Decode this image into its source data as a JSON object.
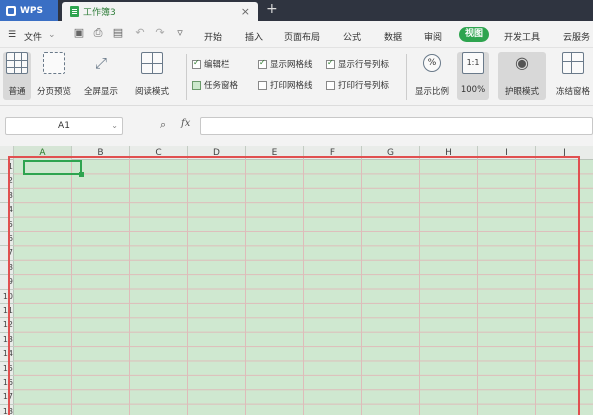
{
  "titlebar": {
    "app_label": "WPS",
    "doc_tab": "工作簿3",
    "close": "×",
    "new_tab": "+"
  },
  "menu": {
    "file": "文件",
    "tabs": [
      "开始",
      "插入",
      "页面布局",
      "公式",
      "数据",
      "审阅",
      "视图",
      "开发工具",
      "云服务"
    ],
    "active_tab": "视图"
  },
  "ribbon": {
    "buttons": [
      "普通",
      "分页预览",
      "全屏显示",
      "阅读模式",
      "显示比例",
      "100%",
      "护眼模式",
      "冻结窗格"
    ],
    "checks": [
      {
        "label": "编辑栏",
        "checked": true
      },
      {
        "label": "任务窗格",
        "checked": false
      },
      {
        "label": "显示网格线",
        "checked": true
      },
      {
        "label": "打印网格线",
        "checked": false
      },
      {
        "label": "显示行号列标",
        "checked": true
      },
      {
        "label": "打印行号列标",
        "checked": false
      }
    ]
  },
  "formula": {
    "name_box": "A1",
    "fx": "fx",
    "value": ""
  },
  "sheet": {
    "columns": [
      "A",
      "B",
      "C",
      "D",
      "E",
      "F",
      "G",
      "H",
      "I",
      "J"
    ],
    "rows": [
      "1",
      "2",
      "3",
      "4",
      "5",
      "6",
      "7",
      "8",
      "9",
      "10",
      "11",
      "12",
      "13",
      "14",
      "15",
      "16",
      "17",
      "18"
    ],
    "active_cell": "A1",
    "cell_color": "#cfe8d0",
    "highlight_color": "#e05050"
  }
}
